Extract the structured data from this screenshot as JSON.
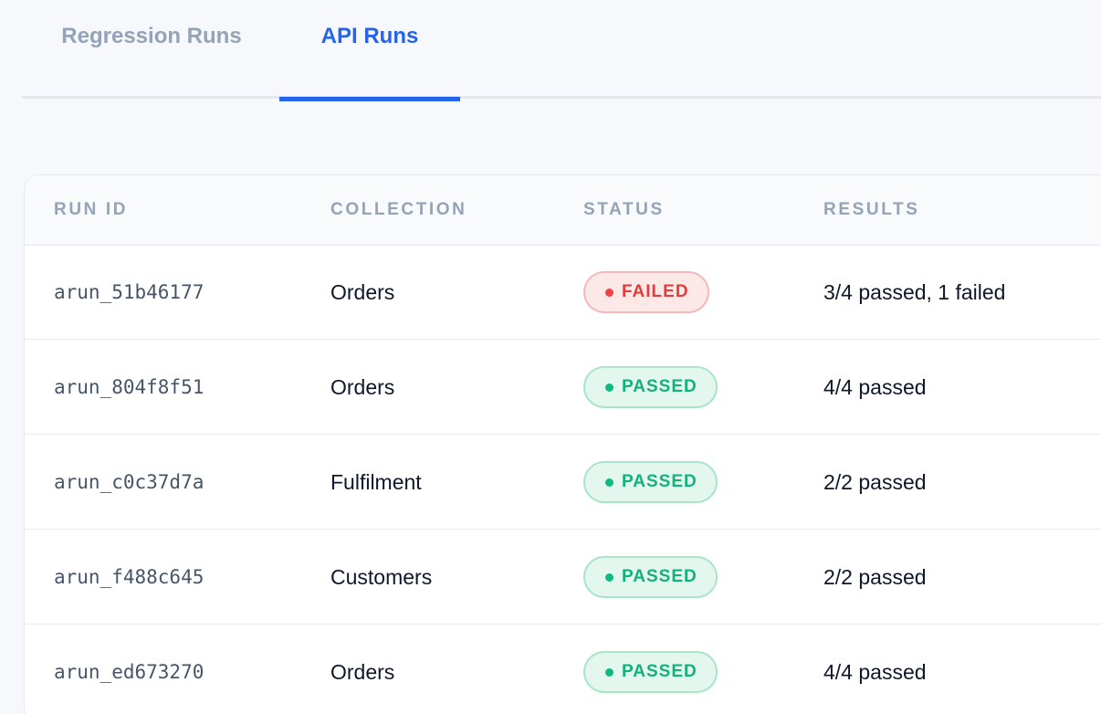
{
  "tabs": [
    {
      "label": "Regression Runs",
      "active": false
    },
    {
      "label": "API Runs",
      "active": true
    }
  ],
  "table": {
    "headers": {
      "run_id": "RUN ID",
      "collection": "COLLECTION",
      "status": "STATUS",
      "results": "RESULTS"
    },
    "rows": [
      {
        "run_id": "arun_51b46177",
        "collection": "Orders",
        "status": "FAILED",
        "results": "3/4 passed, 1 failed"
      },
      {
        "run_id": "arun_804f8f51",
        "collection": "Orders",
        "status": "PASSED",
        "results": "4/4 passed"
      },
      {
        "run_id": "arun_c0c37d7a",
        "collection": "Fulfilment",
        "status": "PASSED",
        "results": "2/2 passed"
      },
      {
        "run_id": "arun_f488c645",
        "collection": "Customers",
        "status": "PASSED",
        "results": "2/2 passed"
      },
      {
        "run_id": "arun_ed673270",
        "collection": "Orders",
        "status": "PASSED",
        "results": "4/4 passed"
      }
    ]
  },
  "colors": {
    "accent": "#2563eb",
    "failed": "#ef4444",
    "passed": "#10b981"
  }
}
